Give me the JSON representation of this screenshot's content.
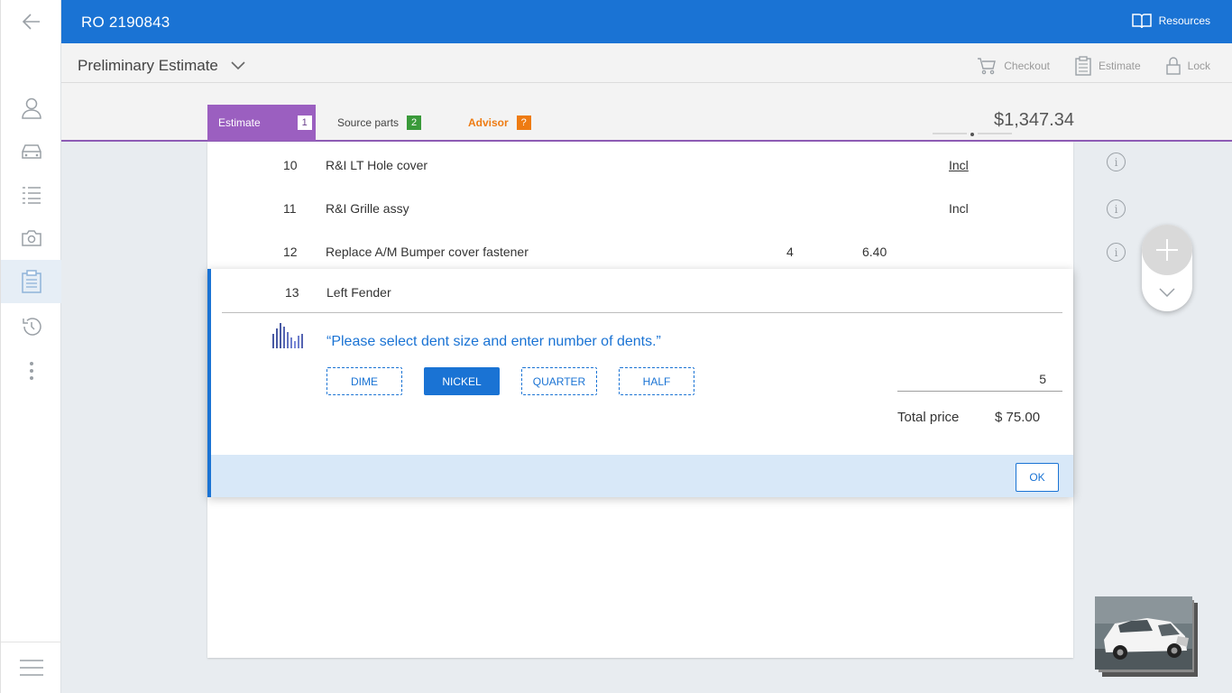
{
  "header": {
    "ro_number": "RO 2190843",
    "resources_label": "Resources"
  },
  "subheader": {
    "title": "Preliminary Estimate",
    "checkout_label": "Checkout",
    "estimate_label": "Estimate",
    "lock_label": "Lock"
  },
  "tabs": [
    {
      "label": "Estimate",
      "badge": "1"
    },
    {
      "label": "Source parts",
      "badge": "2"
    },
    {
      "label": "Advisor",
      "badge": "?"
    }
  ],
  "total_amount": "$1,347.34",
  "lines": [
    {
      "line": "10",
      "description": "R&I LT Hole cover",
      "qty": "",
      "price": "",
      "incl": "Incl"
    },
    {
      "line": "11",
      "description": "R&I Grille assy",
      "qty": "",
      "price": "",
      "incl": "Incl"
    },
    {
      "line": "12",
      "description": "Replace A/M Bumper cover fastener",
      "qty": "4",
      "price": "6.40",
      "incl": ""
    }
  ],
  "dialog": {
    "line": "13",
    "description": "Left Fender",
    "prompt": "“Please select dent size and enter number of dents.”",
    "sizes": [
      "DIME",
      "NICKEL",
      "QUARTER",
      "HALF"
    ],
    "selected_size": "NICKEL",
    "dent_count": "5",
    "total_price_label": "Total price",
    "total_price_value": "$ 75.00",
    "ok_label": "OK"
  },
  "colors": {
    "brand_blue": "#1a73d4",
    "estimate_tab": "#9b5fc0",
    "source_badge": "#3a9a3a",
    "advisor_orange": "#ee7b12"
  },
  "icons": {
    "rail": [
      "back-arrow-icon",
      "person-icon",
      "car-icon",
      "list-icon",
      "camera-icon",
      "clipboard-icon",
      "history-icon",
      "more-vertical-icon",
      "menu-icon"
    ]
  }
}
